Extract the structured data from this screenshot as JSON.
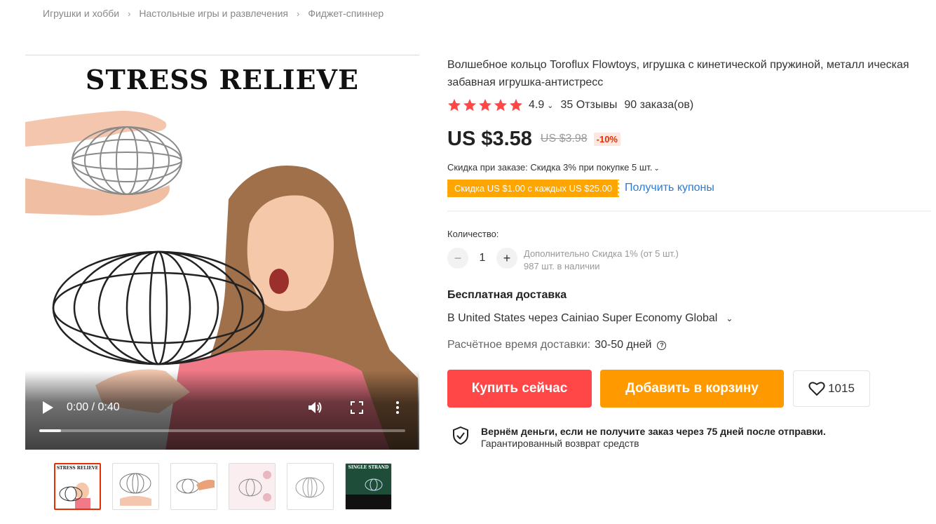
{
  "breadcrumb": [
    "Игрушки и хобби",
    "Настольные игры и развлечения",
    "Фиджет-спиннер"
  ],
  "video": {
    "headline": "STRESS RELIEVE",
    "time": "0:00 / 0:40",
    "progress": 0.06
  },
  "thumbnails": [
    {
      "label": "STRESS RELIEVE",
      "name": "thumbnail-1"
    },
    {
      "label": "",
      "name": "thumbnail-2"
    },
    {
      "label": "",
      "name": "thumbnail-3"
    },
    {
      "label": "",
      "name": "thumbnail-4"
    },
    {
      "label": "",
      "name": "thumbnail-5"
    },
    {
      "label": "SINGLE STRAND",
      "name": "thumbnail-6"
    }
  ],
  "product": {
    "title": "Волшебное кольцо Toroflux Flowtoys, игрушка с кинетической пружиной, металл ическая забавная игрушка-антистресс",
    "rating": "4.9",
    "reviews": "35 Отзывы",
    "orders": "90 заказа(ов)",
    "price": "US $3.58",
    "old_price": "US $3.98",
    "discount": "-10%",
    "order_discount": "Скидка при заказе: Скидка 3% при покупке 5 шт.",
    "coupon": "Скидка US $1.00 с каждых US $25.00",
    "coupon_link": "Получить купоны"
  },
  "quantity": {
    "label": "Количество:",
    "value": "1",
    "extra_discount": "Дополнительно Скидка 1% (от 5 шт.)",
    "stock": "987 шт. в наличии"
  },
  "shipping": {
    "title": "Бесплатная доставка",
    "method": "В United States через Cainiao Super Economy Global",
    "time_label": "Расчётное время доставки:",
    "time_value": "30-50 дней"
  },
  "actions": {
    "buy": "Купить сейчас",
    "cart": "Добавить в корзину",
    "wishlist_count": "1015"
  },
  "guarantee": {
    "title": "Вернём деньги, если не получите заказ через 75 дней после отправки.",
    "subtitle": "Гарантированный возврат средств"
  },
  "colors": {
    "star": "#ff4747",
    "buy_button": "#ff4747",
    "cart_button": "#ff9900",
    "coupon": "#ffa500",
    "discount_text": "#e62e04"
  }
}
